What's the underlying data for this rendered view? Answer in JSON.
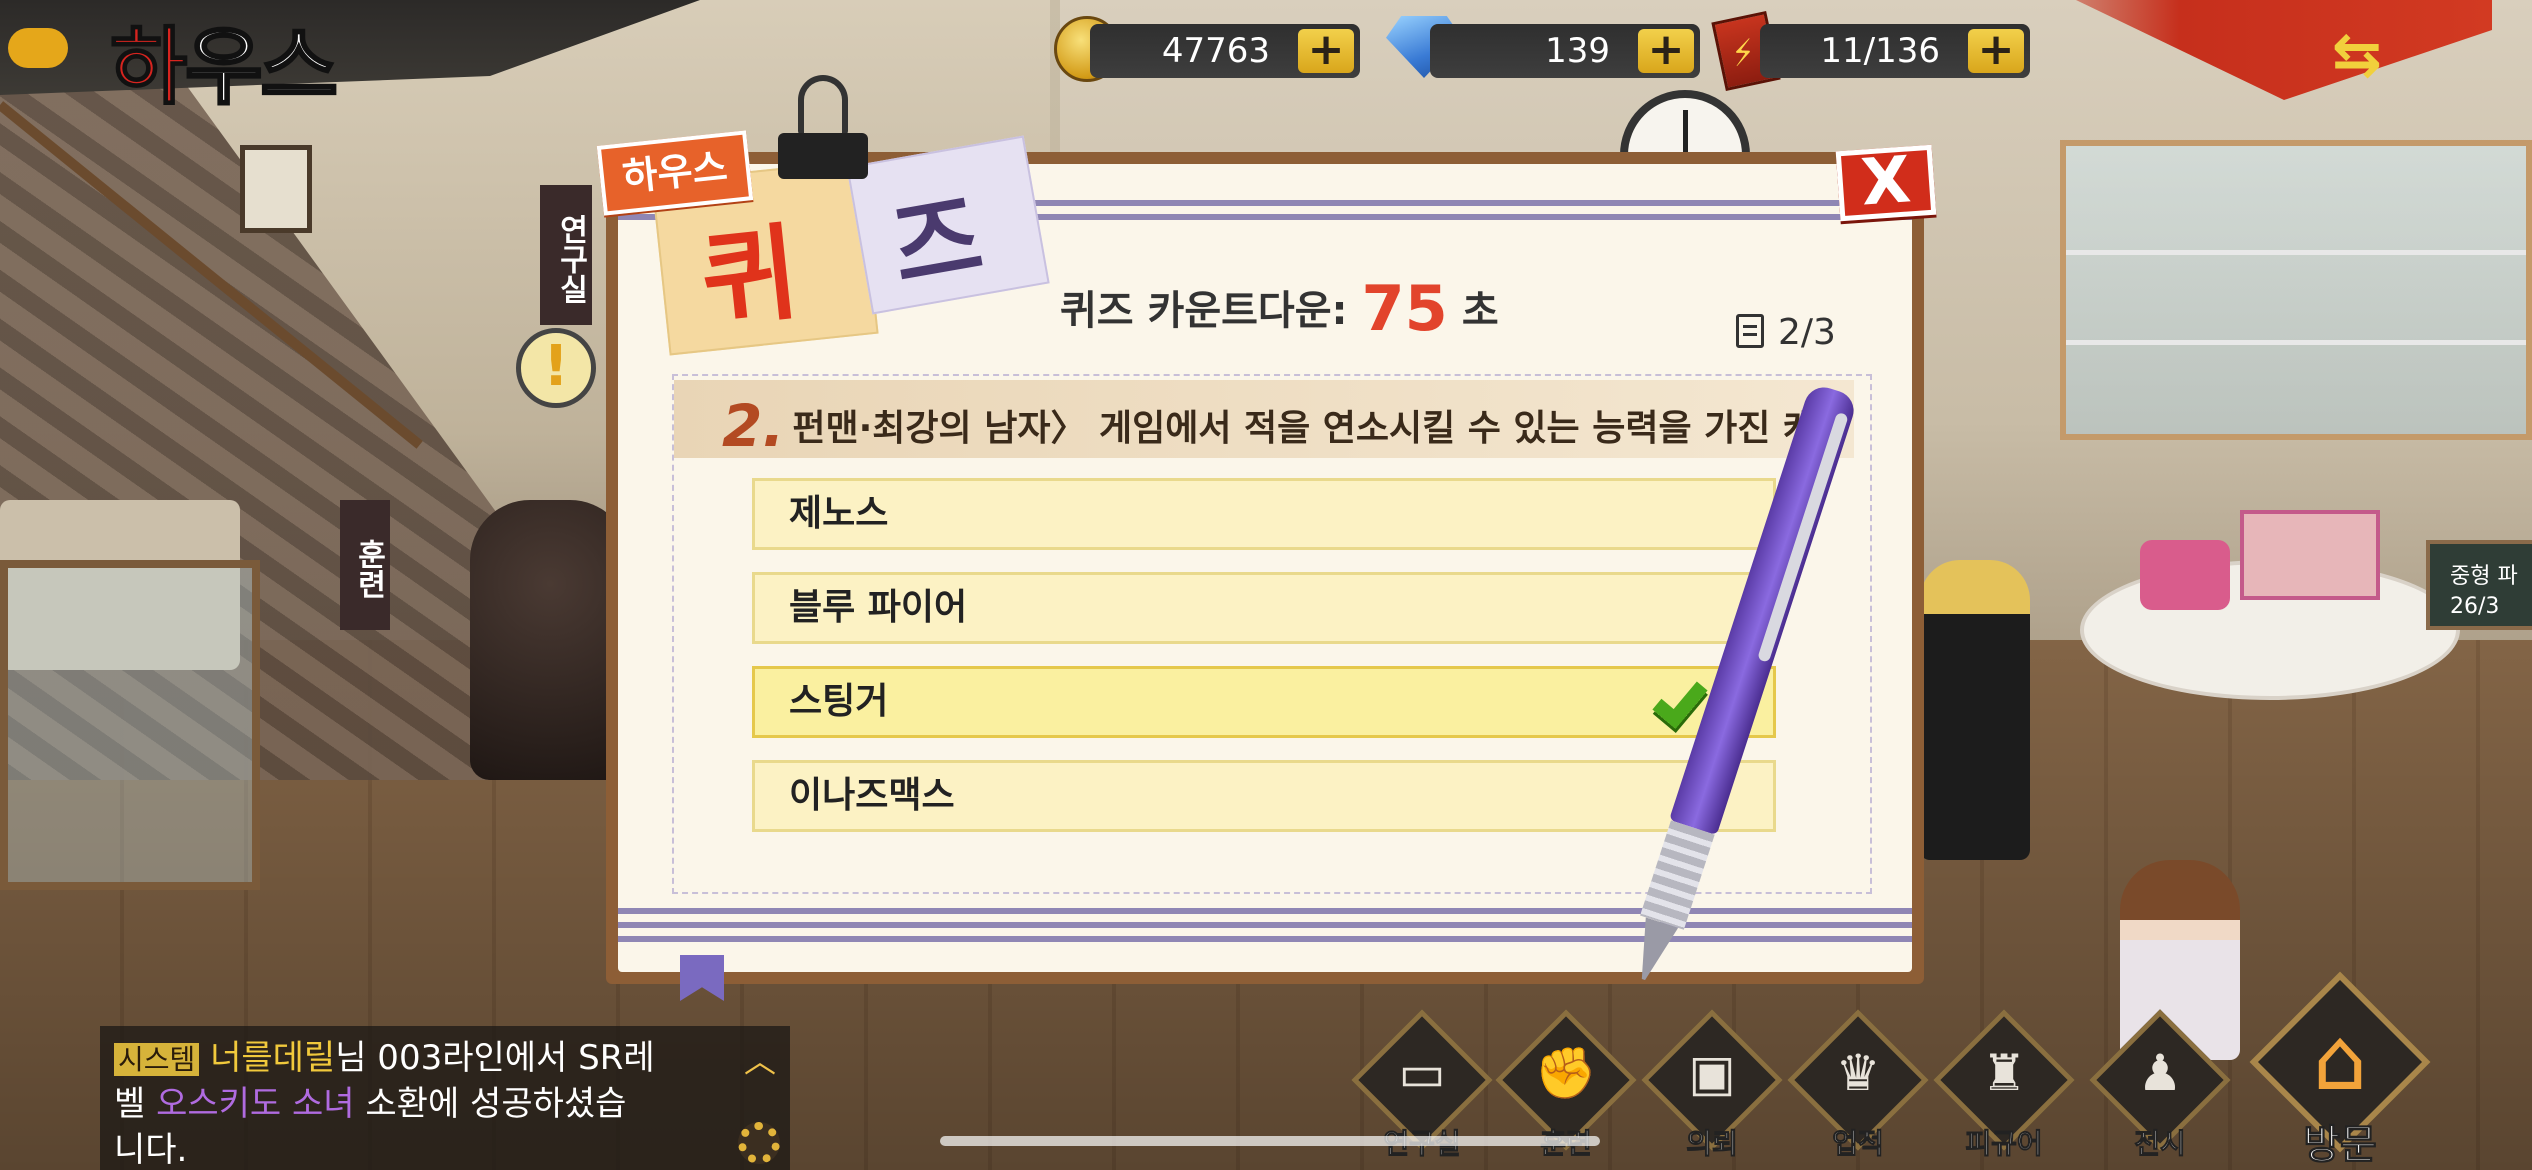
{
  "header": {
    "title_part1": "하",
    "title_part2": "우스",
    "resources": {
      "coins": "47763",
      "gems": "139",
      "tickets": "11/136",
      "plus": "+"
    }
  },
  "scene": {
    "lab_label": "연구실",
    "lab_alert": "!",
    "training_label": "훈련",
    "right_sign": "중형 파",
    "right_sign_count": "26/3"
  },
  "quiz": {
    "tag": "하우스",
    "title_char1": "퀴",
    "title_char2": "즈",
    "close": "X",
    "countdown_label": "퀴즈 카운트다운:",
    "countdown_value": "75",
    "countdown_unit": "초",
    "progress": "2/3",
    "question_number": "2.",
    "question_text": "펀맨·최강의 남자〉 게임에서 적을 연소시킬 수 있는 능력을 가진 캐",
    "options": [
      {
        "label": "제노스",
        "selected": false
      },
      {
        "label": "블루 파이어",
        "selected": false
      },
      {
        "label": "스팅거",
        "selected": true
      },
      {
        "label": "이나즈맥스",
        "selected": false
      }
    ]
  },
  "chat": {
    "line1_sys": "시스템",
    "line1_name": "너를데릴",
    "line1_rest": "님 003라인에서 SR레",
    "line2_prefix": "벨 ",
    "line2_item": "오스키도 소녀",
    "line2_rest": " 소환에 성공하셨습",
    "line3": "니다."
  },
  "menu": {
    "items": [
      {
        "label": "연구실",
        "icon": "laptop-icon"
      },
      {
        "label": "훈련",
        "icon": "fist-icon"
      },
      {
        "label": "의뢰",
        "icon": "monitor-icon"
      },
      {
        "label": "업적",
        "icon": "trophy-icon"
      },
      {
        "label": "피규어",
        "icon": "figure-icon"
      },
      {
        "label": "전시",
        "icon": "person-icon"
      }
    ],
    "visit_label": "방문"
  },
  "colors": {
    "accent_red": "#e2442c",
    "option_bg": "#fcf2c4",
    "selected_check": "#4aa91b",
    "panel_frame": "#8d5e36"
  }
}
